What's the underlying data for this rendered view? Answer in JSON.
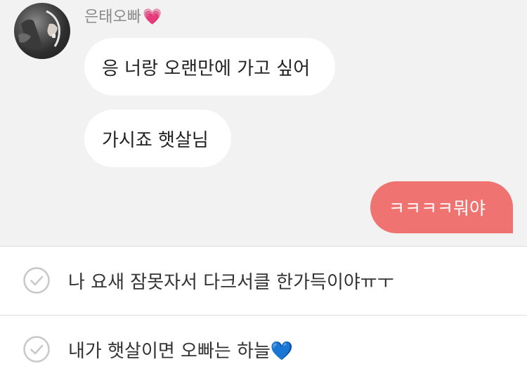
{
  "conversation": {
    "sender_name": "은태오빠",
    "sender_emoji": "💗",
    "incoming_messages": [
      "응 너랑 오랜만에 가고 싶어",
      "가시죠 햇살님"
    ],
    "outgoing_message": "ㅋㅋㅋㅋ뭐야"
  },
  "reply_options": [
    {
      "text": "나 요새 잠못자서 다크서클 한가득이야ㅠㅜ"
    },
    {
      "text": "내가 햇살이면 오빠는 하늘💙"
    }
  ],
  "colors": {
    "chat_background": "#f2f2f2",
    "incoming_bubble": "#ffffff",
    "outgoing_bubble": "#ef7370",
    "check_icon": "#c8c8c8"
  }
}
